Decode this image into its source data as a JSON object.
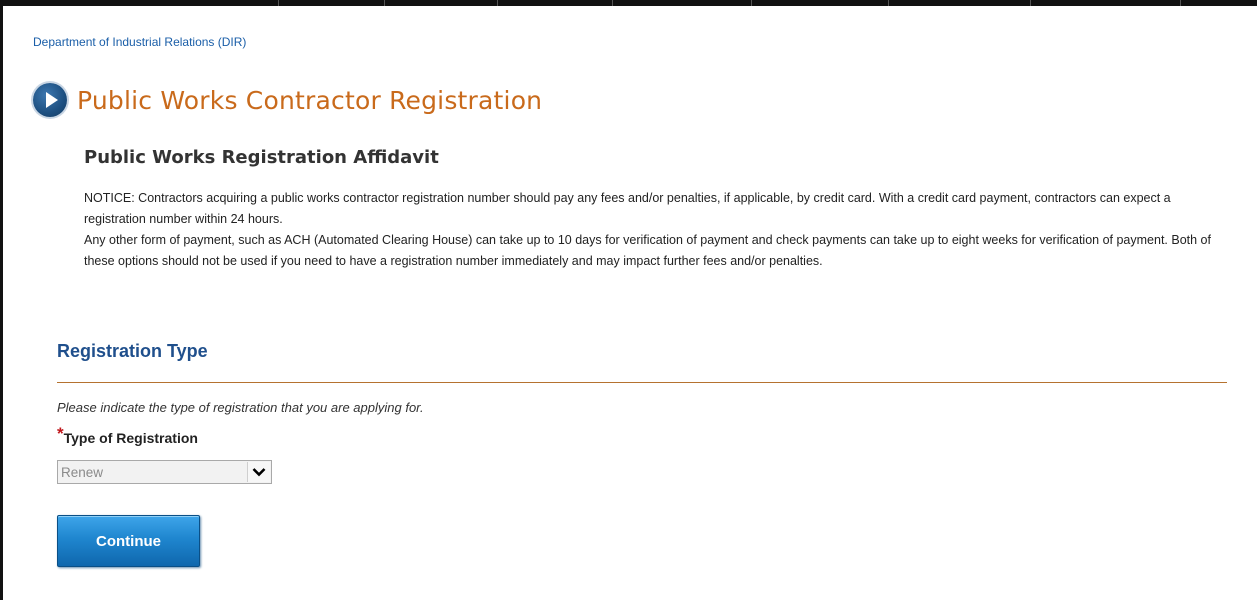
{
  "header": {
    "breadcrumb": "Department of Industrial Relations (DIR)",
    "page_title": "Public Works Contractor Registration"
  },
  "affidavit": {
    "title": "Public Works Registration Affidavit",
    "notice_paragraph_1": "NOTICE: Contractors acquiring a public works contractor registration number should pay any fees and/or penalties, if applicable, by credit card. With a credit card payment, contractors can expect a registration number within 24 hours.",
    "notice_paragraph_2": "Any other form of payment, such as ACH (Automated Clearing House) can take up to 10 days for verification of payment and check payments can take up to eight weeks for verification of payment. Both of these options should not be used if you need to have a registration number immediately and may impact further fees and/or penalties."
  },
  "registration_type": {
    "heading": "Registration Type",
    "instruction": "Please indicate the type of registration that you are applying for.",
    "required_marker": "*",
    "field_label": "Type of Registration",
    "selected_value": "Renew"
  },
  "actions": {
    "continue_label": "Continue"
  },
  "icons": {
    "title_icon": "circle-play-arrow-icon",
    "dropdown_icon": "chevron-down-icon"
  },
  "colors": {
    "title": "#c96a1b",
    "section_heading": "#1f4f8c",
    "link": "#1a5ea8",
    "rule": "#b5722f",
    "required": "#c0151a",
    "button": "#1f86cf"
  }
}
